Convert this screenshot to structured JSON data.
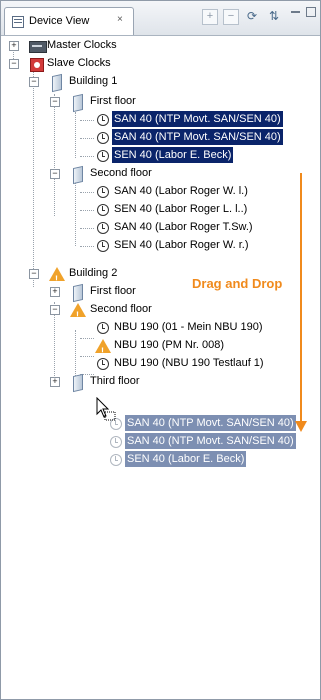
{
  "tab": {
    "label": "Device View",
    "close": "×"
  },
  "toolbar": {
    "expand": "+",
    "collapse": "−",
    "refresh": "⟳",
    "sort": "⇅"
  },
  "tree": {
    "master_clocks": "Master Clocks",
    "slave_clocks": "Slave Clocks",
    "building1": "Building 1",
    "b1_first_floor": "First floor",
    "b1_ff_items": [
      "SAN 40 (NTP Movt. SAN/SEN 40)",
      "SAN 40 (NTP Movt. SAN/SEN 40)",
      "SEN 40 (Labor E. Beck)"
    ],
    "b1_second_floor": "Second floor",
    "b1_sf_items": [
      "SAN 40 (Labor Roger W. l.)",
      "SEN 40 (Labor Roger L. l..)",
      "SAN 40 (Labor Roger T.Sw.)",
      "SEN 40 (Labor Roger W. r.)"
    ],
    "building2": "Building 2",
    "b2_first_floor": "First floor",
    "b2_second_floor": "Second floor",
    "b2_sf_items": [
      "NBU 190 (01 - Mein NBU 190)",
      "NBU 190 (PM Nr. 008)",
      "NBU 190 (NBU 190 Testlauf 1)"
    ],
    "b2_third_floor": "Third floor"
  },
  "drag": {
    "label": "Drag and Drop",
    "items": [
      "SAN 40 (NTP Movt. SAN/SEN 40)",
      "SAN 40 (NTP Movt. SAN/SEN 40)",
      "SEN 40 (Labor E. Beck)"
    ]
  },
  "colors": {
    "selection": "#0a246a",
    "drag_arrow": "#f08a1c",
    "warning": "#f0a22a"
  }
}
